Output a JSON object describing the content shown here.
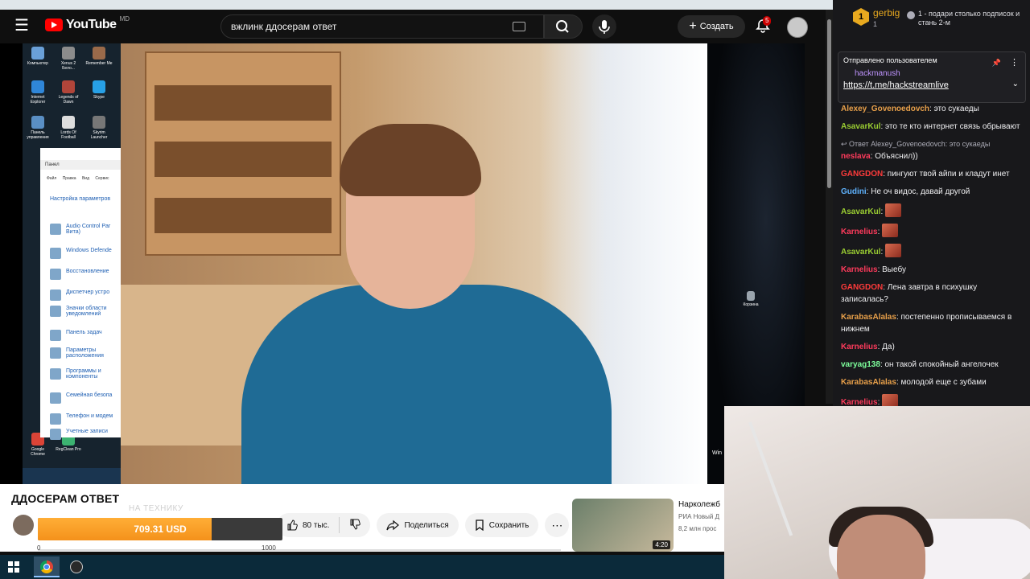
{
  "youtube": {
    "logo_text": "YouTube",
    "logo_region": "MD",
    "search_query": "вжлинк ддосерам ответ",
    "create_label": "Создать",
    "notification_count": "5",
    "video_title": "ДДОСЕРАМ ОТВЕТ",
    "likes": "80 тыс.",
    "share_label": "Поделиться",
    "save_label": "Сохранить",
    "recommended": {
      "title": "Нарколежб",
      "channel": "РИА Новый Д",
      "meta": "8,2 млн прос",
      "duration": "4:20"
    }
  },
  "desktop": {
    "icons_left": [
      {
        "label": "Компьютер"
      },
      {
        "label": "Xenus 2 Бело..."
      },
      {
        "label": "Remember Me"
      },
      {
        "label": "Internet Explorer"
      },
      {
        "label": "Legends of Dawn"
      },
      {
        "label": "Skype"
      },
      {
        "label": "Панель управления"
      },
      {
        "label": "Lords Of Football"
      },
      {
        "label": "Skyrim Launcher"
      },
      {
        "label": "Google Chrome"
      },
      {
        "label": "RegClean Pro"
      }
    ],
    "icon_right": "Корзина",
    "control_panel": {
      "address": "Панел",
      "menu": [
        "Файл",
        "Правка",
        "Вид",
        "Сервис"
      ],
      "heading": "Настройка параметров",
      "items": [
        "Audio Control Par Вита)",
        "Windows Defende",
        "Восстановление",
        "Диспетчер устро",
        "Значки области уведомлений",
        "Панель задач",
        "Параметры расположения",
        "Программы и компоненты",
        "Семейная безопа",
        "Телефон и модем",
        "Учетные записи"
      ]
    },
    "right_edge_text": "Win"
  },
  "donation": {
    "label": "НА ТЕХНИКУ",
    "amount": "709.31 USD",
    "progress": 0.709,
    "scale_min": "0",
    "scale_max": "1000"
  },
  "chat": {
    "user": "gerbig",
    "user_sub": "1",
    "rank": "1",
    "gift_text": "1 - подари столько подписок и стань 2-м",
    "pinned": {
      "label": "Отправлено пользователем",
      "user": "hackmanush",
      "link": "https://t.me/hackstreamlive"
    },
    "messages": [
      {
        "user": "Alexey_Govenoedovch",
        "color": "#e8a04a",
        "text": ": это сукаеды"
      },
      {
        "user": "AsavarKul",
        "color": "#9acd32",
        "text": ": это те кто интернет связь обрывают"
      },
      {
        "reply": "Ответ Alexey_Govenoedovch: это сукаеды",
        "user": "neslava",
        "color": "#ff3b5c",
        "text": ": Объяснил))"
      },
      {
        "user": "GANGDON",
        "color": "#ff3b3b",
        "text": ": пингуют твой айпи и кладут инет"
      },
      {
        "user": "Gudini",
        "color": "#5fb3ff",
        "text": ": Не оч видос, давай другой"
      },
      {
        "user": "AsavarKul",
        "color": "#9acd32",
        "text": ":",
        "emote": true
      },
      {
        "user": "Karnelius",
        "color": "#ff3b5c",
        "text": ":",
        "emote": true
      },
      {
        "user": "AsavarKul",
        "color": "#9acd32",
        "text": ":",
        "emote": true
      },
      {
        "user": "Karnelius",
        "color": "#ff3b5c",
        "text": ": Выебу"
      },
      {
        "user": "GANGDON",
        "color": "#ff3b3b",
        "text": ": Лена завтра в психушку записалась?"
      },
      {
        "user": "KarabasAlalas",
        "color": "#e8a04a",
        "text": ": постепенно прописываемся в нижнем"
      },
      {
        "user": "Karnelius",
        "color": "#ff3b5c",
        "text": ": Да)"
      },
      {
        "user": "varyag138",
        "color": "#7cfc9a",
        "text": ": он такой спокойный ангелочек"
      },
      {
        "user": "KarabasAlalas",
        "color": "#e8a04a",
        "text": ": молодой еще с зубами"
      },
      {
        "user": "Karnelius",
        "color": "#ff3b5c",
        "text": ":",
        "emote": true
      }
    ]
  },
  "taskbar": {
    "items": [
      "start",
      "chrome",
      "obs"
    ]
  }
}
